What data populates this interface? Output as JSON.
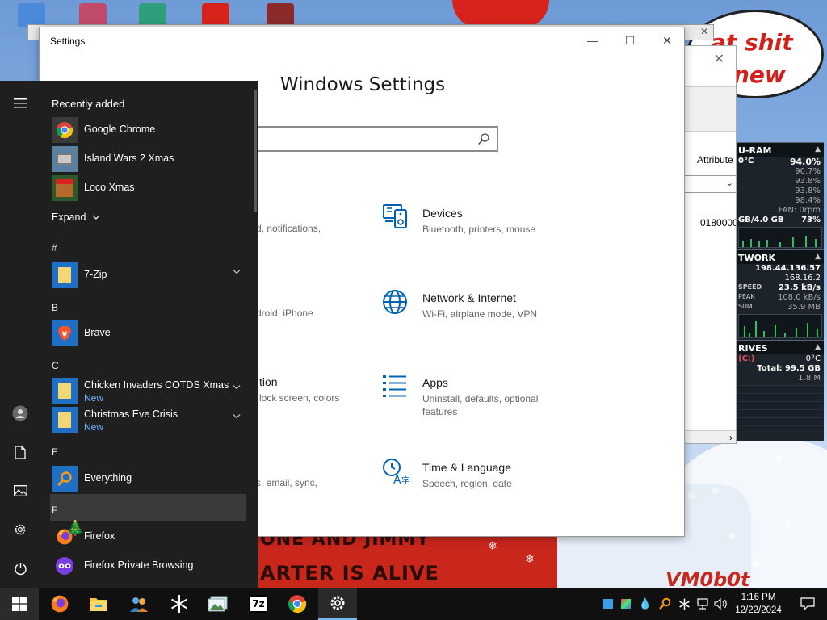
{
  "wallpaper": {
    "speech_line1": "at shit",
    "speech_line2": "new",
    "banner_line1": "ONE AND JIMMY",
    "banner_line2": "ARTER IS ALIVE",
    "signature": "VM0b0t"
  },
  "background_window": {
    "attribute_label": "Attribute",
    "attribute_value": "0180000"
  },
  "gadget": {
    "cpu_ram": {
      "header": "U-RAM",
      "temp": "0°C",
      "total": "94.0%",
      "cores": [
        "90.7%",
        "93.8%",
        "93.8%",
        "98.4%"
      ],
      "fan": "FAN: 0rpm",
      "ram_label": "GB/4.0 GB",
      "ram_pct": "73%"
    },
    "network": {
      "header": "TWORK",
      "ip1": "198.44.136.57",
      "ip2": "168.16.2",
      "speed_label": "SPEED",
      "speed": "23.5 kB/s",
      "peak_label": "PEAK",
      "peak": "108.0 kB/s",
      "sum_label": "SUM",
      "sum": "35.9 MB"
    },
    "drives": {
      "header": "RIVES",
      "drive": "(C:)",
      "temp": "0°C",
      "total": "Total: 99.5 GB",
      "used": "1.8 M"
    }
  },
  "settings": {
    "window_title": "Settings",
    "minimize_glyph": "—",
    "maximize_glyph": "☐",
    "close_glyph": "✕",
    "heading": "Windows Settings",
    "search_placeholder": "a setting",
    "left_col": {
      "system_desc": "d, notifications,",
      "phone_desc": "droid, iPhone",
      "personal_name": "tion",
      "personal_desc": "lock screen, colors",
      "accounts_desc": "s, email, sync,"
    },
    "tiles": [
      {
        "name": "Devices",
        "desc": "Bluetooth, printers, mouse",
        "icon": "devices-icon"
      },
      {
        "name": "Network & Internet",
        "desc": "Wi-Fi, airplane mode, VPN",
        "icon": "globe-icon"
      },
      {
        "name": "Apps",
        "desc": "Uninstall, defaults, optional features",
        "icon": "apps-list-icon"
      },
      {
        "name": "Time & Language",
        "desc": "Speech, region, date",
        "icon": "time-language-icon"
      }
    ]
  },
  "start_menu": {
    "recently_added": "Recently added",
    "recent": [
      {
        "name": "Google Chrome"
      },
      {
        "name": "Island Wars 2 Xmas"
      },
      {
        "name": "Loco Xmas"
      }
    ],
    "expand": "Expand",
    "sections": {
      "hash": "#",
      "b": "B",
      "c": "C",
      "e": "E",
      "f": "F"
    },
    "apps": {
      "sevenzip": "7-Zip",
      "brave": "Brave",
      "chicken": "Chicken Invaders COTDS Xmas",
      "chicken_badge": "New",
      "christmas": "Christmas Eve Crisis",
      "christmas_badge": "New",
      "everything": "Everything",
      "firefox": "Firefox",
      "firefox_private": "Firefox Private Browsing"
    }
  },
  "taskbar": {
    "time": "1:16 PM",
    "date": "12/22/2024",
    "tb_7z_label": "7z"
  }
}
